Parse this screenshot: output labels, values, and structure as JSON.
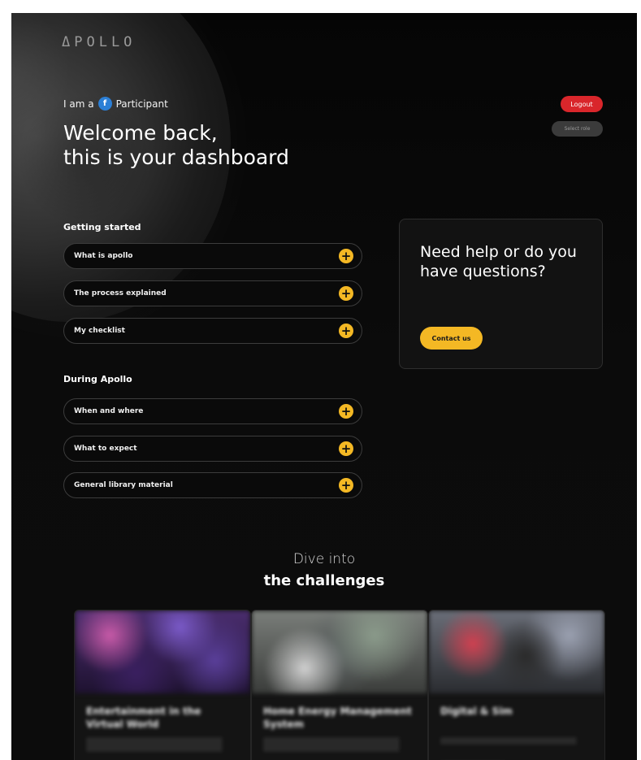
{
  "header": {
    "logo": "ΔPOLLO",
    "role_prefix": "I am a",
    "role_name": "Participant",
    "role_icon_glyph": "f",
    "welcome_line1": "Welcome back,",
    "welcome_line2": "this is your dashboard",
    "logout_label": "Logout",
    "select_role_label": "Select role"
  },
  "getting_started": {
    "title": "Getting started",
    "items": [
      {
        "label": "What is apollo"
      },
      {
        "label": "The process explained"
      },
      {
        "label": "My checklist"
      }
    ]
  },
  "during_apollo": {
    "title": "During Apollo",
    "items": [
      {
        "label": "When and where"
      },
      {
        "label": "What to expect"
      },
      {
        "label": "General library material"
      }
    ]
  },
  "help_card": {
    "title": "Need help or do you have questions?",
    "contact_label": "Contact us"
  },
  "challenges": {
    "heading_line1": "Dive into",
    "heading_line2": "the challenges",
    "cards": [
      {
        "title": "Entertainment in the Virtual World"
      },
      {
        "title": "Home Energy Management System"
      },
      {
        "title": "Digital & Sim"
      }
    ]
  },
  "colors": {
    "background": "#0b0b0b",
    "accent": "#f4b824",
    "logout": "#d9262b",
    "role_icon": "#2b7fd6"
  },
  "icons": {
    "accordion_expand": "plus-icon",
    "role": "role-icon"
  }
}
